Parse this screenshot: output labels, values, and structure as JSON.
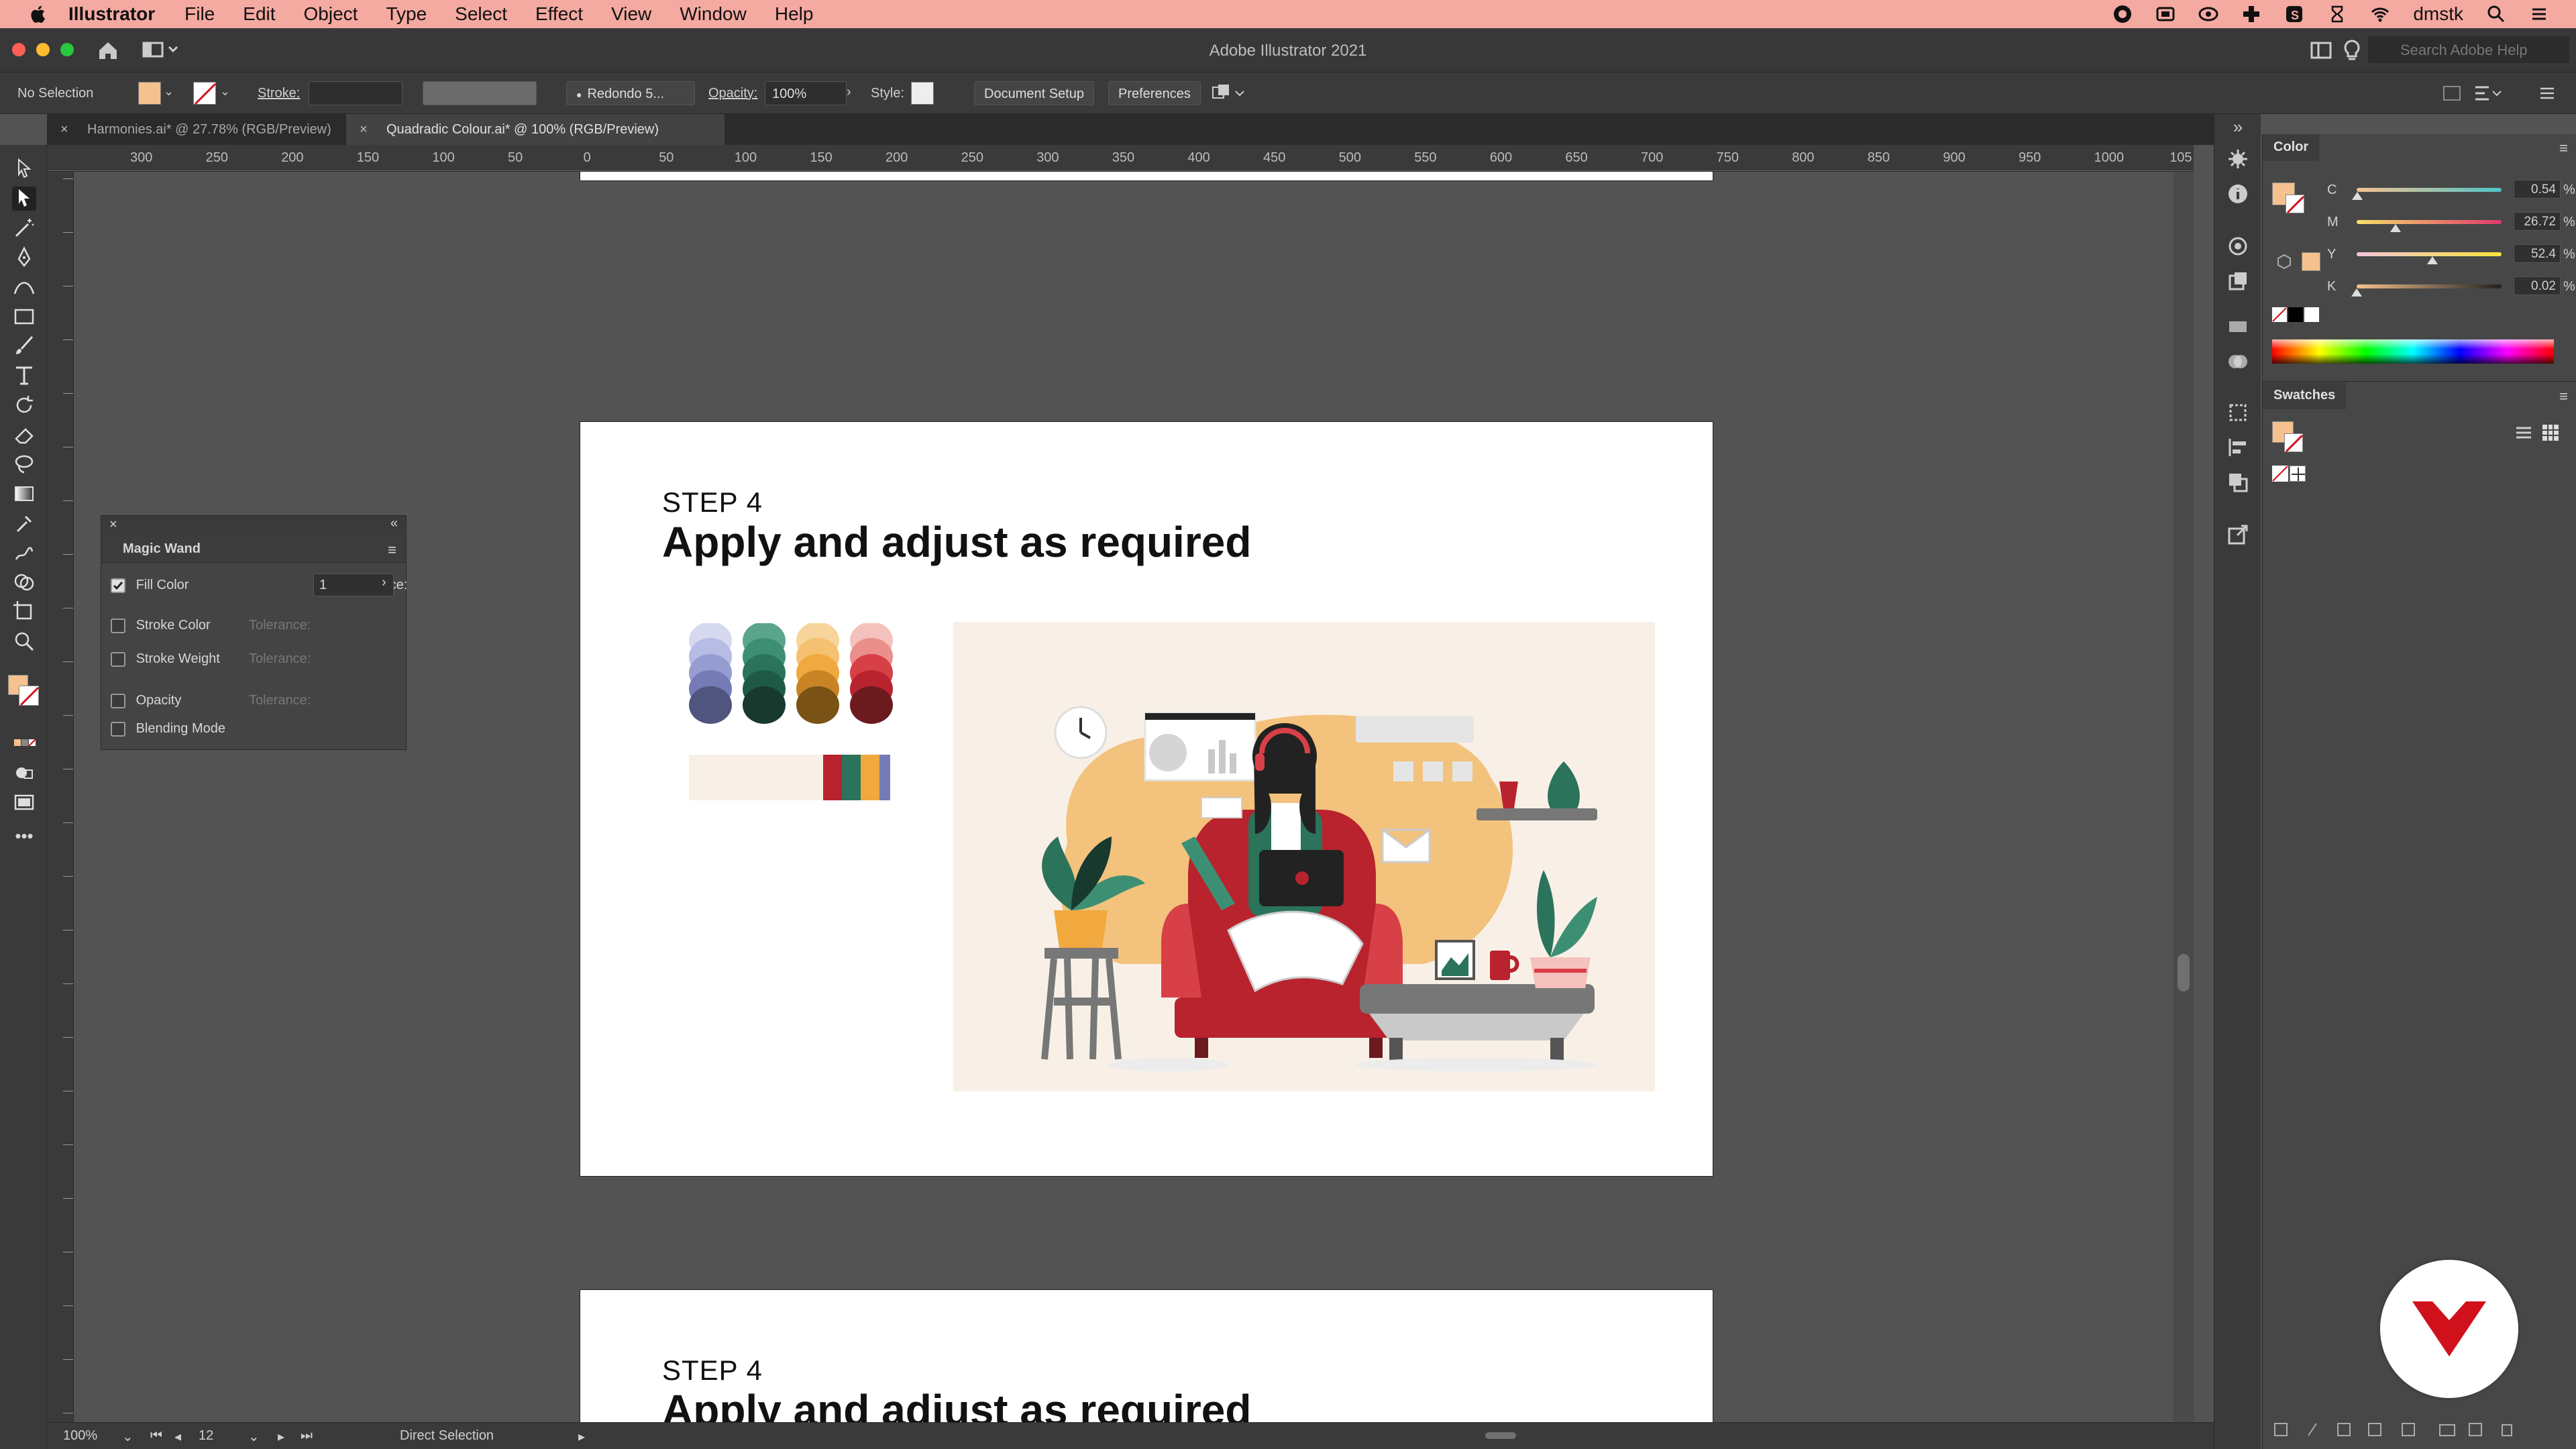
{
  "menubar": {
    "app_name": "Illustrator",
    "items": [
      "File",
      "Edit",
      "Object",
      "Type",
      "Select",
      "Effect",
      "View",
      "Window",
      "Help"
    ],
    "user": "dmstk"
  },
  "window": {
    "title": "Adobe Illustrator 2021",
    "search_placeholder": "Search Adobe Help"
  },
  "controlbar": {
    "selection": "No Selection",
    "stroke_label": "Stroke:",
    "brush": "Redondo 5...",
    "opacity_label": "Opacity:",
    "opacity_value": "100%",
    "style_label": "Style:",
    "document_setup": "Document Setup",
    "preferences": "Preferences"
  },
  "tabs": [
    {
      "label": "Harmonies.ai* @ 27.78% (RGB/Preview)",
      "active": false
    },
    {
      "label": "Quadradic Colour.ai* @ 100% (RGB/Preview)",
      "active": true
    }
  ],
  "ruler": {
    "top_ticks": [
      "300",
      "250",
      "200",
      "150",
      "100",
      "50",
      "0",
      "50",
      "100",
      "150",
      "200",
      "250",
      "300",
      "350",
      "400",
      "450",
      "500",
      "550",
      "600",
      "650",
      "700",
      "750",
      "800",
      "850",
      "900",
      "950",
      "1000",
      "105"
    ]
  },
  "artboard": {
    "step_label": "STEP 4",
    "title": "Apply and adjust as required",
    "palette": {
      "columns": [
        [
          "#d5d8ef",
          "#b6bce4",
          "#959ccf",
          "#747bb5",
          "#4f557e"
        ],
        [
          "#5aa58a",
          "#3d8f74",
          "#2b735b",
          "#1f5a47",
          "#17392e"
        ],
        [
          "#f6d49a",
          "#f5c070",
          "#f0a83f",
          "#c88424",
          "#7a5215"
        ],
        [
          "#f5c1bd",
          "#ea8f8a",
          "#d84048",
          "#b8232e",
          "#6b1a1e"
        ]
      ],
      "strip": [
        "#f8f0e6",
        "#b8232e",
        "#2b735b",
        "#f0a83f",
        "#747bb5"
      ]
    },
    "illustration_bg": "#f8f0e6"
  },
  "magic_wand": {
    "title": "Magic Wand",
    "rows": [
      {
        "label": "Fill Color",
        "checked": true,
        "tolerance_label": "Tolerance:",
        "tolerance": "1"
      },
      {
        "label": "Stroke Color",
        "checked": false,
        "tolerance_label": "Tolerance:",
        "tolerance": ""
      },
      {
        "label": "Stroke Weight",
        "checked": false,
        "tolerance_label": "Tolerance:",
        "tolerance": ""
      },
      {
        "label": "Opacity",
        "checked": false,
        "tolerance_label": "Tolerance:",
        "tolerance": ""
      },
      {
        "label": "Blending Mode",
        "checked": false
      }
    ]
  },
  "color_panel": {
    "title": "Color",
    "fill": "#f5c18e",
    "C": {
      "label": "C",
      "value": "0.54",
      "level": 0.0054
    },
    "M": {
      "label": "M",
      "value": "26.72",
      "level": 0.2672
    },
    "Y": {
      "label": "Y",
      "value": "52.4",
      "level": 0.524
    },
    "K": {
      "label": "K",
      "value": "0.02",
      "level": 0.0002
    },
    "pct": "%"
  },
  "swatches_panel": {
    "title": "Swatches"
  },
  "statusbar": {
    "zoom": "100%",
    "artboard": "12",
    "tool": "Direct Selection"
  },
  "colors": {
    "menubar": "#f4a9a1",
    "chrome": "#3a3a3a",
    "canvas": "#535353",
    "brand_badge": "#d0111c"
  }
}
